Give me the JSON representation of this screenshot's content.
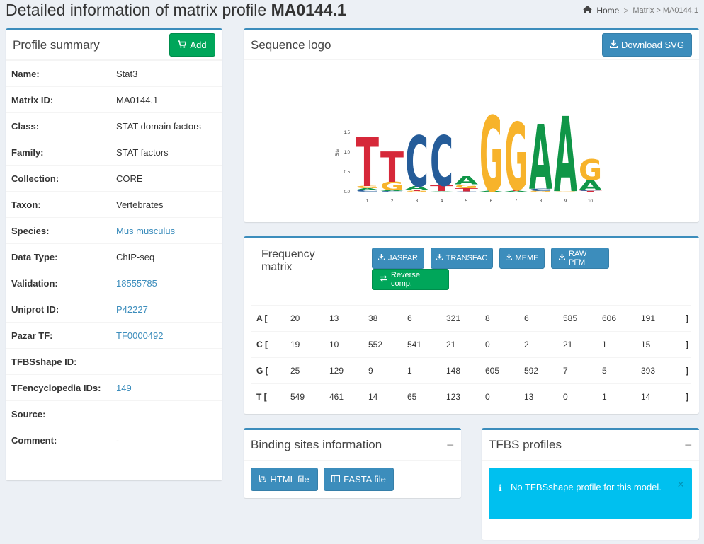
{
  "page": {
    "title_prefix": "Detailed information of matrix profile ",
    "title_id": "MA0144.1"
  },
  "breadcrumb": {
    "home": "Home",
    "sep": ">",
    "current": "Matrix > MA0144.1"
  },
  "summary": {
    "title": "Profile summary",
    "add_label": "Add",
    "rows": [
      {
        "k": "Name:",
        "v": "Stat3",
        "link": false
      },
      {
        "k": "Matrix ID:",
        "v": "MA0144.1",
        "link": false
      },
      {
        "k": "Class:",
        "v": "STAT domain factors",
        "link": false
      },
      {
        "k": "Family:",
        "v": "STAT factors",
        "link": false
      },
      {
        "k": "Collection:",
        "v": "CORE",
        "link": false
      },
      {
        "k": "Taxon:",
        "v": "Vertebrates",
        "link": false
      },
      {
        "k": "Species:",
        "v": "Mus musculus",
        "link": true
      },
      {
        "k": "Data Type:",
        "v": "ChIP-seq",
        "link": false
      },
      {
        "k": "Validation:",
        "v": "18555785",
        "link": true
      },
      {
        "k": "Uniprot ID:",
        "v": "P42227",
        "link": true
      },
      {
        "k": "Pazar TF:",
        "v": "TF0000492",
        "link": true
      },
      {
        "k": "TFBSshape ID:",
        "v": "",
        "link": false
      },
      {
        "k": "TFencyclopedia IDs:",
        "v": "149",
        "link": true
      },
      {
        "k": "Source:",
        "v": "",
        "link": false
      },
      {
        "k": "Comment:",
        "v": "-",
        "link": false
      }
    ]
  },
  "logo": {
    "title": "Sequence logo",
    "download_label": "Download SVG",
    "ylabel": "Bits",
    "yticks": [
      "0.0",
      "0.5",
      "1.0",
      "1.5"
    ],
    "xticks": [
      "1",
      "2",
      "3",
      "4",
      "5",
      "6",
      "7",
      "8",
      "9",
      "10"
    ]
  },
  "freq": {
    "title": "Frequency matrix",
    "buttons": [
      "JASPAR",
      "TRANSFAC",
      "MEME",
      "RAW PFM"
    ],
    "reverse_label": "Reverse comp.",
    "rows": [
      {
        "base": "A [",
        "vals": [
          "20",
          "13",
          "38",
          "6",
          "321",
          "8",
          "6",
          "585",
          "606",
          "191"
        ],
        "end": "]"
      },
      {
        "base": "C [",
        "vals": [
          "19",
          "10",
          "552",
          "541",
          "21",
          "0",
          "2",
          "21",
          "1",
          "15"
        ],
        "end": "]"
      },
      {
        "base": "G [",
        "vals": [
          "25",
          "129",
          "9",
          "1",
          "148",
          "605",
          "592",
          "7",
          "5",
          "393"
        ],
        "end": "]"
      },
      {
        "base": "T [",
        "vals": [
          "549",
          "461",
          "14",
          "65",
          "123",
          "0",
          "13",
          "0",
          "1",
          "14"
        ],
        "end": "]"
      }
    ]
  },
  "binding": {
    "title": "Binding sites information",
    "collapse": "−",
    "html_label": "HTML file",
    "fasta_label": "FASTA file"
  },
  "tfbs": {
    "title": "TFBS profiles",
    "collapse": "−",
    "message": "No TFBSshape profile for this model.",
    "info": "i",
    "close": "×"
  },
  "colors": {
    "A": "#109648",
    "C": "#255C99",
    "G": "#F7B32B",
    "T": "#D62839"
  }
}
